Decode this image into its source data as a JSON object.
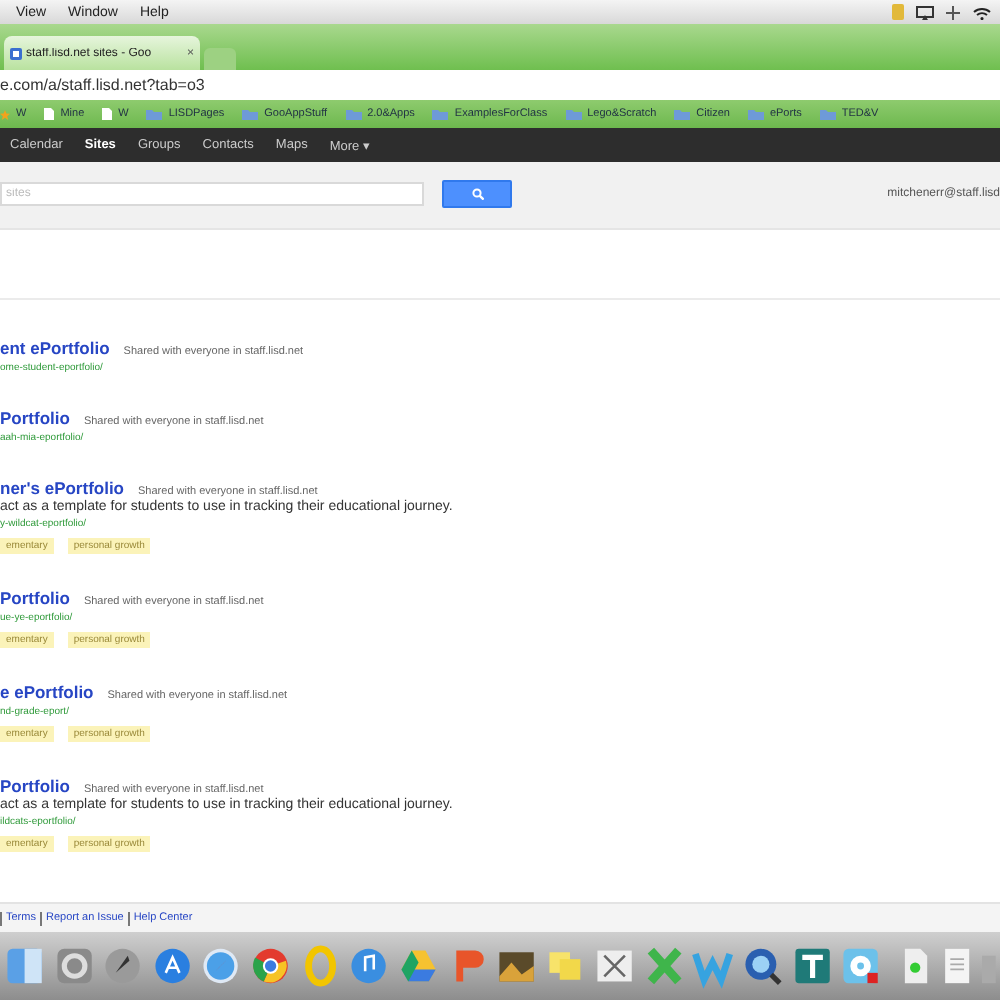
{
  "menubar": {
    "items": [
      "View",
      "Window",
      "Help"
    ]
  },
  "browser": {
    "tab": {
      "title": "staff.lisd.net sites - Goo",
      "close": "×"
    },
    "url": "e.com/a/staff.lisd.net?tab=o3",
    "bookmarks": [
      {
        "label": "W",
        "kind": "star"
      },
      {
        "label": "Mine",
        "kind": "page"
      },
      {
        "label": "W",
        "kind": "page"
      },
      {
        "label": "LISDPages",
        "kind": "folder"
      },
      {
        "label": "GooAppStuff",
        "kind": "folder"
      },
      {
        "label": "2.0&Apps",
        "kind": "folder"
      },
      {
        "label": "ExamplesForClass",
        "kind": "folder"
      },
      {
        "label": "Lego&Scratch",
        "kind": "folder"
      },
      {
        "label": "Citizen",
        "kind": "folder"
      },
      {
        "label": "ePorts",
        "kind": "folder"
      },
      {
        "label": "TED&V",
        "kind": "folder"
      }
    ]
  },
  "gbar": {
    "items": [
      {
        "label": "Calendar",
        "selected": false
      },
      {
        "label": "Sites",
        "selected": true
      },
      {
        "label": "Groups",
        "selected": false
      },
      {
        "label": "Contacts",
        "selected": false
      },
      {
        "label": "Maps",
        "selected": false
      },
      {
        "label": "More ▾",
        "selected": false
      }
    ]
  },
  "search": {
    "placeholder": "sites",
    "account": "mitchenerr@staff.lisd"
  },
  "sites": [
    {
      "title": "ent ePortfolio",
      "shared": "Shared with everyone in staff.lisd.net",
      "url": "ome-student-eportfolio/"
    },
    {
      "title": "Portfolio",
      "shared": "Shared with everyone in staff.lisd.net",
      "url": "aah-mia-eportfolio/"
    },
    {
      "title": "ner's ePortfolio",
      "shared": "Shared with everyone in staff.lisd.net",
      "description": "act as a template for students to use in tracking their educational journey.",
      "url": "y-wildcat-eportfolio/",
      "tags": [
        "ementary",
        "personal growth"
      ]
    },
    {
      "title": "Portfolio",
      "shared": "Shared with everyone in staff.lisd.net",
      "url": "ue-ye-eportfolio/",
      "tags": [
        "ementary",
        "personal growth"
      ]
    },
    {
      "title": "e ePortfolio",
      "shared": "Shared with everyone in staff.lisd.net",
      "url": "nd-grade-eport/",
      "tags": [
        "ementary",
        "personal growth"
      ]
    },
    {
      "title": "Portfolio",
      "shared": "Shared with everyone in staff.lisd.net",
      "description": "act as a template for students to use in tracking their educational journey.",
      "url": "ildcats-eportfolio/",
      "tags": [
        "ementary",
        "personal growth"
      ]
    }
  ],
  "footer": {
    "links": [
      "Terms",
      "Report an Issue",
      "Help Center"
    ]
  }
}
